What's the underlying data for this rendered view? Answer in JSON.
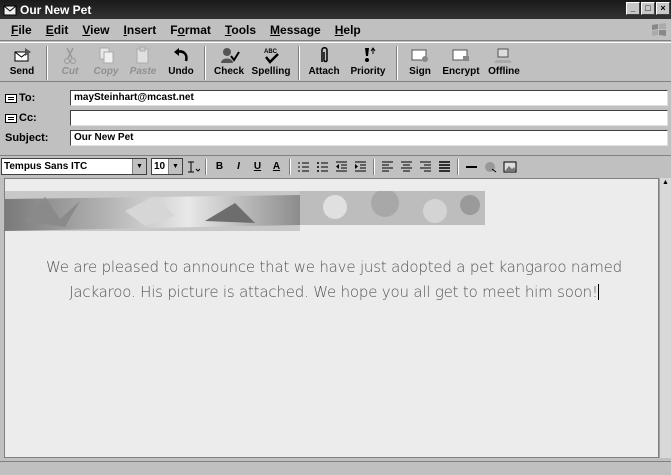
{
  "window": {
    "title": "Our New Pet",
    "controls": [
      "_",
      "□",
      "×"
    ]
  },
  "menu": [
    {
      "label": "File",
      "acc": "F",
      "rest": "ile"
    },
    {
      "label": "Edit",
      "acc": "E",
      "rest": "dit"
    },
    {
      "label": "View",
      "acc": "V",
      "rest": "iew"
    },
    {
      "label": "Insert",
      "acc": "I",
      "rest": "nsert"
    },
    {
      "label": "Format",
      "pre": "F",
      "acc": "o",
      "rest": "rmat"
    },
    {
      "label": "Tools",
      "acc": "T",
      "rest": "ools"
    },
    {
      "label": "Message",
      "acc": "M",
      "rest": "essage"
    },
    {
      "label": "Help",
      "acc": "H",
      "rest": "elp"
    }
  ],
  "toolbar": {
    "send": "Send",
    "cut": "Cut",
    "copy": "Copy",
    "paste": "Paste",
    "undo": "Undo",
    "check": "Check",
    "spelling": "Spelling",
    "spelling_icon_text": "ABC",
    "attach": "Attach",
    "priority": "Priority",
    "sign": "Sign",
    "encrypt": "Encrypt",
    "offline": "Offline"
  },
  "fields": {
    "to_label": "To:",
    "to_value": "maySteinhart@mcast.net",
    "cc_label": "Cc:",
    "cc_value": "",
    "subject_label": "Subject:",
    "subject_value": "Our New Pet"
  },
  "format": {
    "font": "Tempus Sans ITC",
    "size": "10",
    "bold": "B",
    "italic": "I",
    "underline": "U",
    "color": "A"
  },
  "message": {
    "body": "We are pleased to announce that we have just adopted a pet kangaroo named Jackaroo. His picture is attached. We hope you all get to meet him soon!"
  }
}
